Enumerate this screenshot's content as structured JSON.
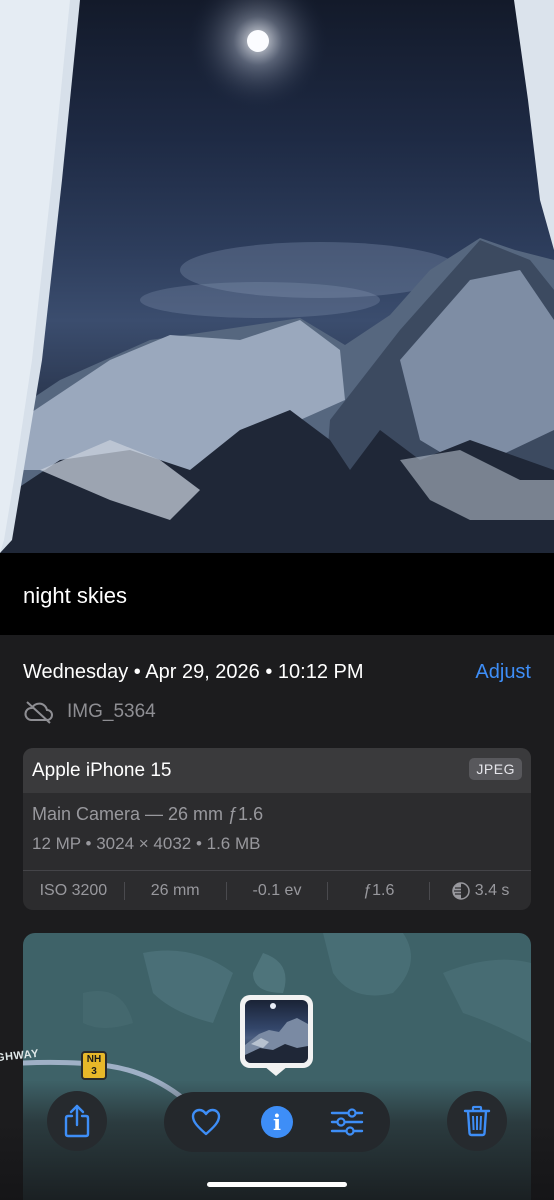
{
  "photo": {
    "caption": "night skies"
  },
  "info": {
    "date_line": "Wednesday • Apr 29, 2026 • 10:12 PM",
    "adjust_label": "Adjust",
    "filename": "IMG_5364",
    "cloud_icon": "cloud-slash-icon"
  },
  "camera": {
    "device": "Apple iPhone 15",
    "format": "JPEG",
    "lens": "Main Camera — 26 mm ƒ1.6",
    "specs": "12 MP • 3024 × 4032 • 1.6 MB",
    "exif": {
      "iso": "ISO 3200",
      "focal": "26 mm",
      "ev": "-0.1 ev",
      "aperture": "ƒ1.6",
      "shutter": "3.4 s"
    }
  },
  "map": {
    "road_label": "GHWAY",
    "shield_prefix": "NH",
    "shield_number": "3"
  },
  "toolbar": {
    "share_icon": "share-icon",
    "favorite_icon": "heart-icon",
    "info_icon": "info-icon",
    "edit_icon": "sliders-icon",
    "delete_icon": "trash-icon",
    "accent": "#3e8ef7"
  }
}
